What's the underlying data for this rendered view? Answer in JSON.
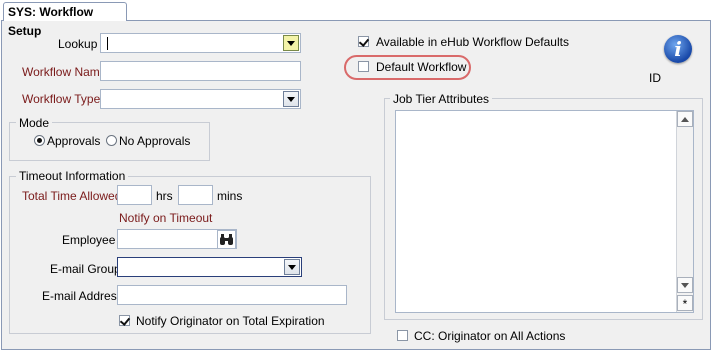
{
  "tab": {
    "title": "SYS: Workflow Setup"
  },
  "form": {
    "lookup_label": "Lookup",
    "workflow_name_label": "Workflow Name",
    "workflow_type_label": "Workflow Type",
    "workflow_name_value": "",
    "workflow_type_value": "",
    "lookup_value": ""
  },
  "mode": {
    "legend": "Mode",
    "options": [
      {
        "label": "Approvals",
        "selected": true
      },
      {
        "label": "No Approvals",
        "selected": false
      }
    ]
  },
  "timeout": {
    "legend": "Timeout Information",
    "total_time_label": "Total Time Allowed",
    "hrs_label": "hrs",
    "mins_label": "mins",
    "notify_label": "Notify on Timeout",
    "employee_label": "Employee",
    "email_group_label": "E-mail Group",
    "email_address_label": "E-mail Address",
    "notify_originator_label": "Notify Originator on Total Expiration",
    "notify_originator_checked": true
  },
  "right": {
    "available_label": "Available in eHub Workflow Defaults",
    "available_checked": true,
    "default_label": "Default Workflow",
    "default_checked": false,
    "id_label": "ID",
    "job_tier_legend": "Job Tier Attributes",
    "new_row_marker": "*",
    "cc_label": "CC: Originator on All Actions",
    "cc_checked": false
  },
  "icons": {
    "info": "info-icon",
    "binoculars": "binoculars-icon",
    "dropdown": "chevron-down-icon"
  },
  "colors": {
    "required_label": "#7a1a1a",
    "highlight_ring": "#d96a6a",
    "lookup_button": "#f3f3a8"
  }
}
